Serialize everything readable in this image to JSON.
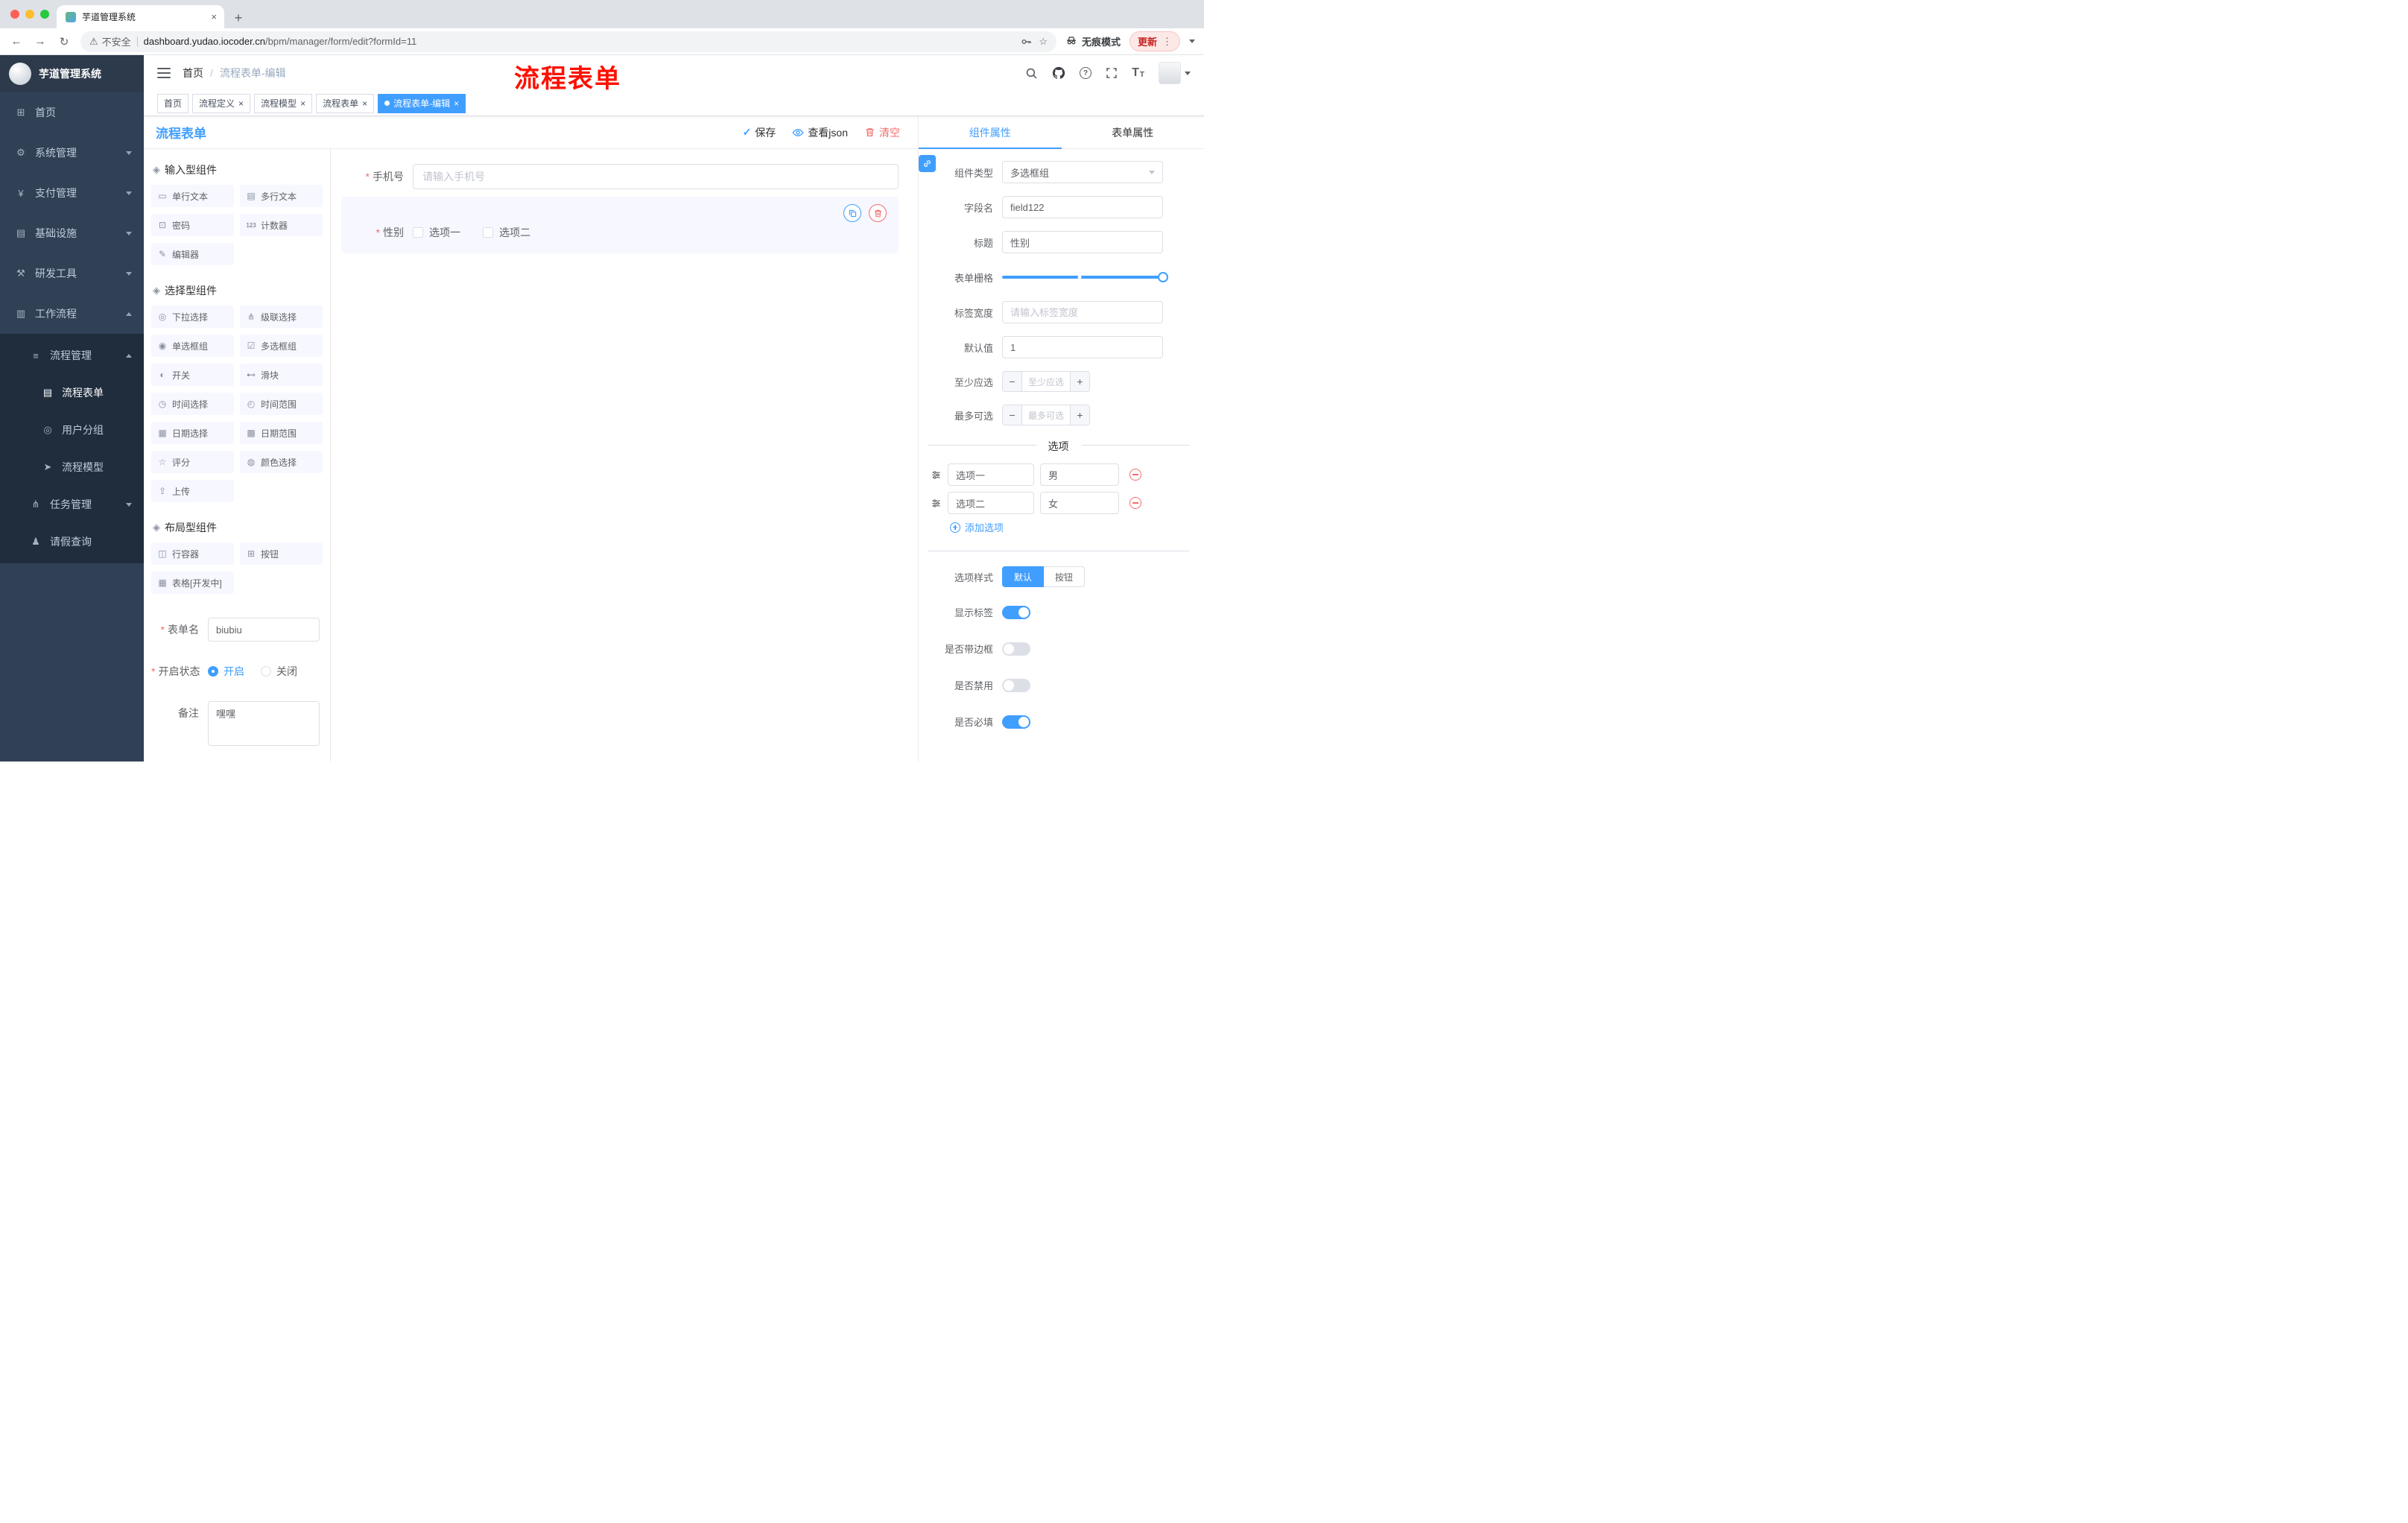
{
  "browser": {
    "tab_title": "芋道管理系统",
    "security_label": "不安全",
    "url_domain": "dashboard.yudao.iocoder.cn",
    "url_path": "/bpm/manager/form/edit?formId=11",
    "incognito_label": "无痕模式",
    "update_label": "更新"
  },
  "icons": {
    "close": "×",
    "plus": "+",
    "back": "←",
    "forward": "→",
    "reload": "↻",
    "warning": "⚠",
    "star": "☆",
    "kebab": "⋮",
    "check": "✓",
    "question": "?",
    "text_size": "T",
    "group_handle": "◈"
  },
  "sidebar": {
    "logo_title": "芋道管理系统",
    "menu": [
      {
        "icon": "⊞",
        "label": "首页",
        "expandable": false
      },
      {
        "icon": "⚙",
        "label": "系统管理",
        "expandable": true
      },
      {
        "icon": "¥",
        "label": "支付管理",
        "expandable": true
      },
      {
        "icon": "▤",
        "label": "基础设施",
        "expandable": true
      },
      {
        "icon": "⚒",
        "label": "研发工具",
        "expandable": true
      },
      {
        "icon": "▥",
        "label": "工作流程",
        "expandable": true,
        "expanded": true
      }
    ],
    "submenu": [
      {
        "icon": "≡",
        "label": "流程管理",
        "level": 1,
        "expanded": true
      },
      {
        "icon": "▤",
        "label": "流程表单",
        "level": 2,
        "active": true
      },
      {
        "icon": "◎",
        "label": "用户分组",
        "level": 2,
        "active": false
      },
      {
        "icon": "➤",
        "label": "流程模型",
        "level": 2,
        "active": false
      },
      {
        "icon": "⋔",
        "label": "任务管理",
        "level": 1,
        "expanded": false
      },
      {
        "icon": "♟",
        "label": "请假查询",
        "level": 1
      }
    ]
  },
  "header": {
    "breadcrumb_home": "首页",
    "breadcrumb_sep": "/",
    "breadcrumb_current": "流程表单-编辑",
    "annotation": "流程表单"
  },
  "tags": [
    {
      "label": "首页",
      "closable": false,
      "active": false
    },
    {
      "label": "流程定义",
      "closable": true,
      "active": false
    },
    {
      "label": "流程模型",
      "closable": true,
      "active": false
    },
    {
      "label": "流程表单",
      "closable": true,
      "active": false
    },
    {
      "label": "流程表单-编辑",
      "closable": true,
      "active": true
    }
  ],
  "designer": {
    "panel_title": "流程表单",
    "actions": {
      "save": "保存",
      "view_json": "查看json",
      "clear": "清空"
    },
    "groups": [
      {
        "title": "输入型组件",
        "items": [
          {
            "icon": "▭",
            "label": "单行文本"
          },
          {
            "icon": "▤",
            "label": "多行文本"
          },
          {
            "icon": "⊡",
            "label": "密码"
          },
          {
            "icon": "123",
            "label": "计数器"
          },
          {
            "icon": "✎",
            "label": "编辑器"
          }
        ]
      },
      {
        "title": "选择型组件",
        "items": [
          {
            "icon": "◎",
            "label": "下拉选择"
          },
          {
            "icon": "⋔",
            "label": "级联选择"
          },
          {
            "icon": "◉",
            "label": "单选框组"
          },
          {
            "icon": "☑",
            "label": "多选框组"
          },
          {
            "icon": "◐",
            "label": "开关"
          },
          {
            "icon": "⊷",
            "label": "滑块"
          },
          {
            "icon": "◷",
            "label": "时间选择"
          },
          {
            "icon": "◴",
            "label": "时间范围"
          },
          {
            "icon": "▦",
            "label": "日期选择"
          },
          {
            "icon": "▩",
            "label": "日期范围"
          },
          {
            "icon": "☆",
            "label": "评分"
          },
          {
            "icon": "◍",
            "label": "颜色选择"
          },
          {
            "icon": "⇪",
            "label": "上传"
          }
        ]
      },
      {
        "title": "布局型组件",
        "items": [
          {
            "icon": "◫",
            "label": "行容器"
          },
          {
            "icon": "⊞",
            "label": "按钮"
          },
          {
            "icon": "▦",
            "label": "表格[开发中]"
          }
        ]
      }
    ],
    "form": {
      "name_label": "表单名",
      "name_value": "biubiu",
      "status_label": "开启状态",
      "status_on": "开启",
      "status_off": "关闭",
      "remark_label": "备注",
      "remark_value": "嘿嘿"
    }
  },
  "canvas": {
    "phone_label": "手机号",
    "phone_placeholder": "请输入手机号",
    "gender_label": "性别",
    "gender_option1": "选项一",
    "gender_option2": "选项二"
  },
  "props": {
    "tab_component": "组件属性",
    "tab_form": "表单属性",
    "component_type_label": "组件类型",
    "component_type_value": "多选框组",
    "field_name_label": "字段名",
    "field_name_value": "field122",
    "title_label": "标题",
    "title_value": "性别",
    "grid_label": "表单栅格",
    "label_width_label": "标签宽度",
    "label_width_placeholder": "请输入标签宽度",
    "default_label": "默认值",
    "default_value": "1",
    "min_label": "至少应选",
    "min_placeholder": "至少应选",
    "max_label": "最多可选",
    "max_placeholder": "最多可选",
    "options_title": "选项",
    "options": [
      {
        "label": "选项一",
        "value": "男"
      },
      {
        "label": "选项二",
        "value": "女"
      }
    ],
    "add_option": "添加选项",
    "style_label": "选项样式",
    "style_default": "默认",
    "style_button": "按钮",
    "toggle_show_label": "显示标签",
    "toggle_border": "是否带边框",
    "toggle_disabled": "是否禁用",
    "toggle_required": "是否必填",
    "toggle_states": {
      "show_label": true,
      "border": false,
      "disabled": false,
      "required": true
    }
  },
  "colors": {
    "accent": "#409eff",
    "danger": "#f56c6c",
    "sidebar_bg": "#304156",
    "submenu_bg": "#1f2d3d",
    "annotation": "#fd1000",
    "selected_widget_bg": "#f6f7ff"
  }
}
